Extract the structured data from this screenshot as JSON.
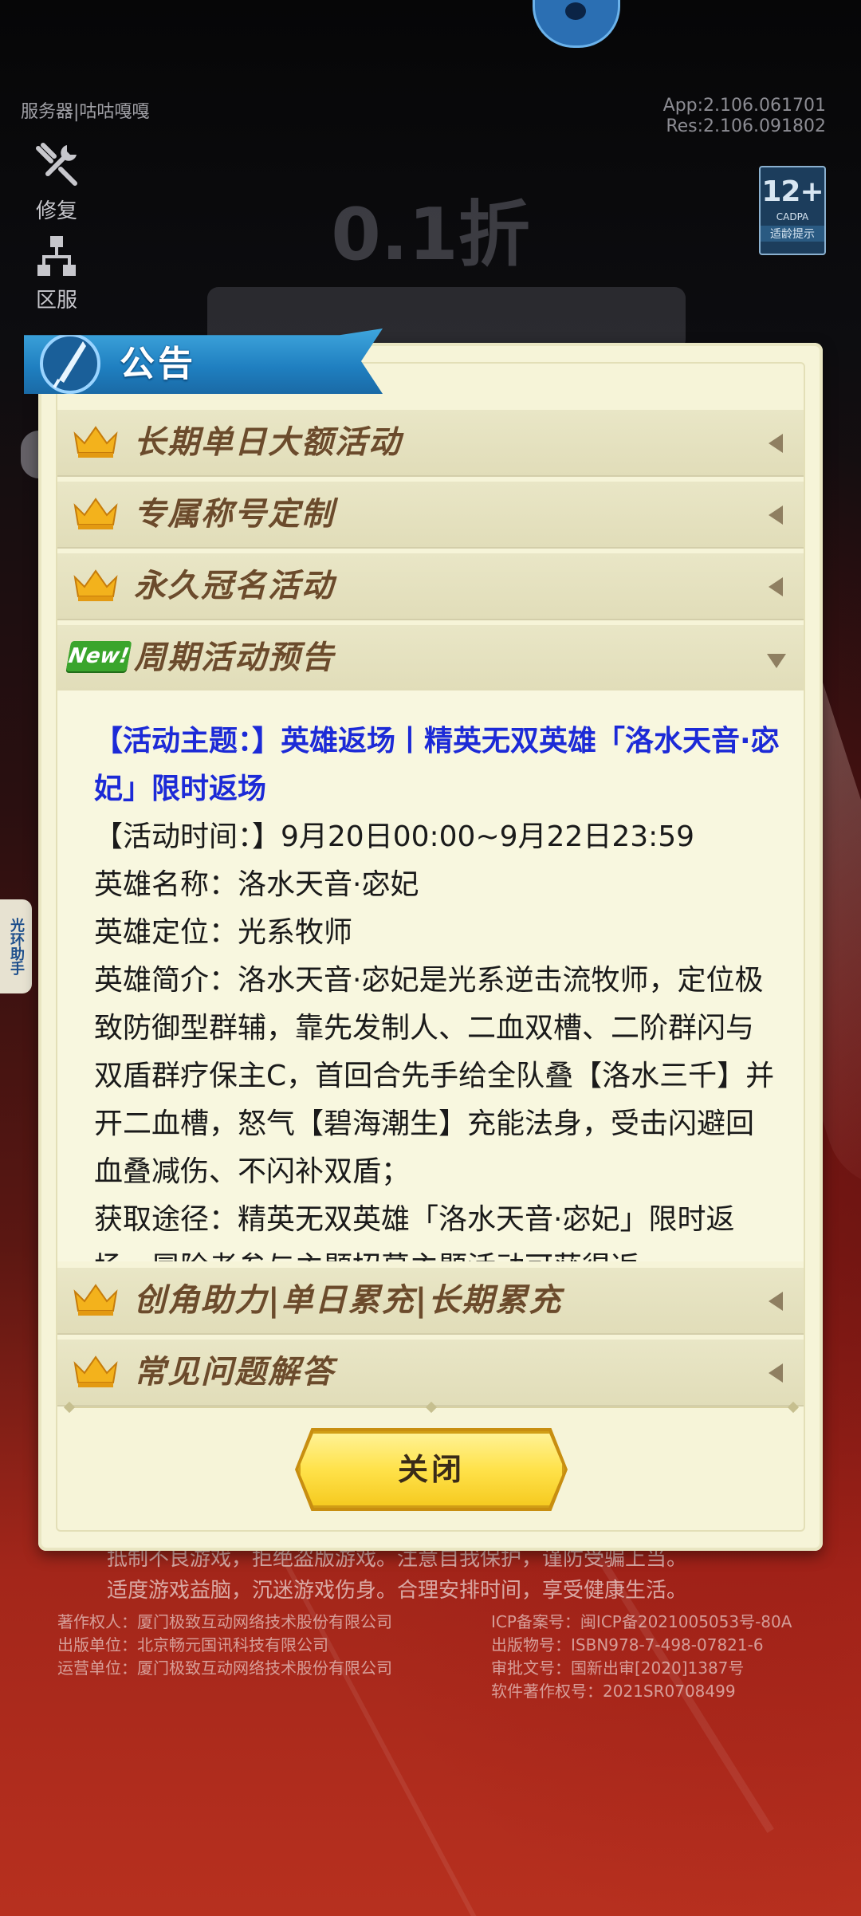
{
  "server_label": "服务器|咕咕嘎嘎",
  "version": {
    "app": "App:2.106.061701",
    "res": "Res:2.106.091802"
  },
  "tools": {
    "repair": "修复",
    "zone": "区服"
  },
  "age_rating": {
    "number": "12+",
    "org": "CADPA",
    "tip": "适龄提示"
  },
  "game_logo_text": "0.1折",
  "side_tab": "光环助手",
  "dialog": {
    "title": "公告",
    "sections": [
      {
        "label": "长期单日大额活动",
        "expanded": false,
        "icon": "crown-icon"
      },
      {
        "label": "专属称号定制",
        "expanded": false,
        "icon": "crown-icon"
      },
      {
        "label": "永久冠名活动",
        "expanded": false,
        "icon": "crown-icon"
      },
      {
        "label": "周期活动预告",
        "expanded": true,
        "icon": "new-badge",
        "badge": "New!"
      },
      {
        "label": "创角助力|单日累充|长期累充",
        "expanded": false,
        "icon": "crown-icon"
      },
      {
        "label": "常见问题解答",
        "expanded": false,
        "icon": "crown-icon"
      }
    ],
    "content": {
      "theme": "【活动主题：】英雄返场丨精英无双英雄「洛水天音·宓妃」限时返场",
      "time": "【活动时间：】9月20日00:00~9月22日23:59",
      "hero_name": "英雄名称：洛水天音·宓妃",
      "hero_role": "英雄定位：光系牧师",
      "hero_intro": "英雄简介：洛水天音·宓妃是光系逆击流牧师，定位极致防御型群辅，靠先发制人、二血双槽、二阶群闪与双盾群疗保主C，首回合先手给全队叠【洛水三千】并开二血槽，怒气【碧海潮生】充能法身，受击闪避回血叠减伤、不闪补双盾；",
      "obtain": "获取途径：精英无双英雄「洛水天音·宓妃」限时返场，冒险者参与主题招募主题活动可获得返"
    },
    "close_label": "关闭"
  },
  "footer": {
    "notice_line1": "抵制不良游戏，拒绝盗版游戏。注意自我保护，谨防受骗上当。",
    "notice_line2": "适度游戏益脑，沉迷游戏伤身。合理安排时间，享受健康生活。",
    "copyright": "著作权人：厦门极致互动网络技术股份有限公司",
    "publisher": "出版单位：北京畅元国讯科技有限公司",
    "operator": "运营单位：厦门极致互动网络技术股份有限公司",
    "icp": "ICP备案号：闽ICP备2021005053号-80A",
    "isbn": "出版物号：ISBN978-7-498-07821-6",
    "approval": "审批文号：国新出审[2020]1387号",
    "software": "软件著作权号：2021SR0708499"
  }
}
